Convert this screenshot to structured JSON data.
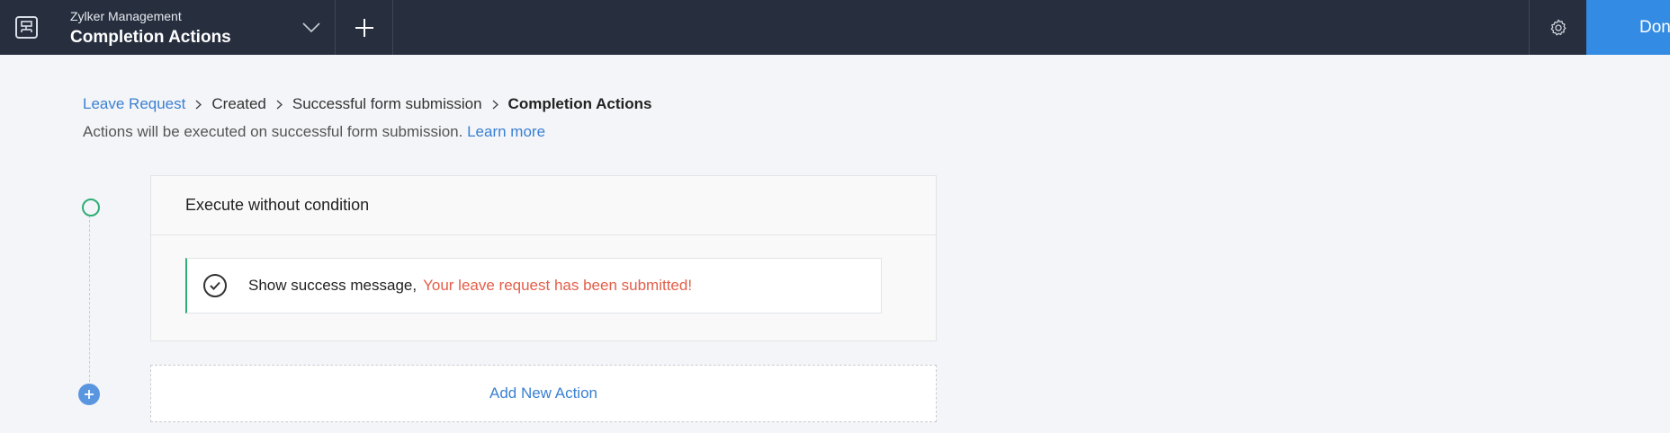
{
  "header": {
    "app_name": "Zylker Management",
    "page_name": "Completion Actions",
    "done_label": "Done",
    "icons": [
      "app-logo-icon",
      "chevron-down-icon",
      "plus-icon",
      "gear-icon"
    ]
  },
  "breadcrumb": [
    {
      "label": "Leave Request",
      "link": true
    },
    {
      "label": "Created",
      "link": false
    },
    {
      "label": "Successful form submission",
      "link": false
    },
    {
      "label": "Completion Actions",
      "current": true
    }
  ],
  "description": {
    "text": "Actions will be executed on successful form submission.",
    "link_label": "Learn more"
  },
  "condition": {
    "title": "Execute without condition",
    "action": {
      "label": "Show success message,",
      "message": "Your leave request has been submitted!"
    }
  },
  "add_action_label": "Add New Action",
  "colors": {
    "topbar": "#272f3f",
    "accent": "#338be4",
    "link": "#3a80d2",
    "success": "#2eae77",
    "message": "#e35e48"
  }
}
